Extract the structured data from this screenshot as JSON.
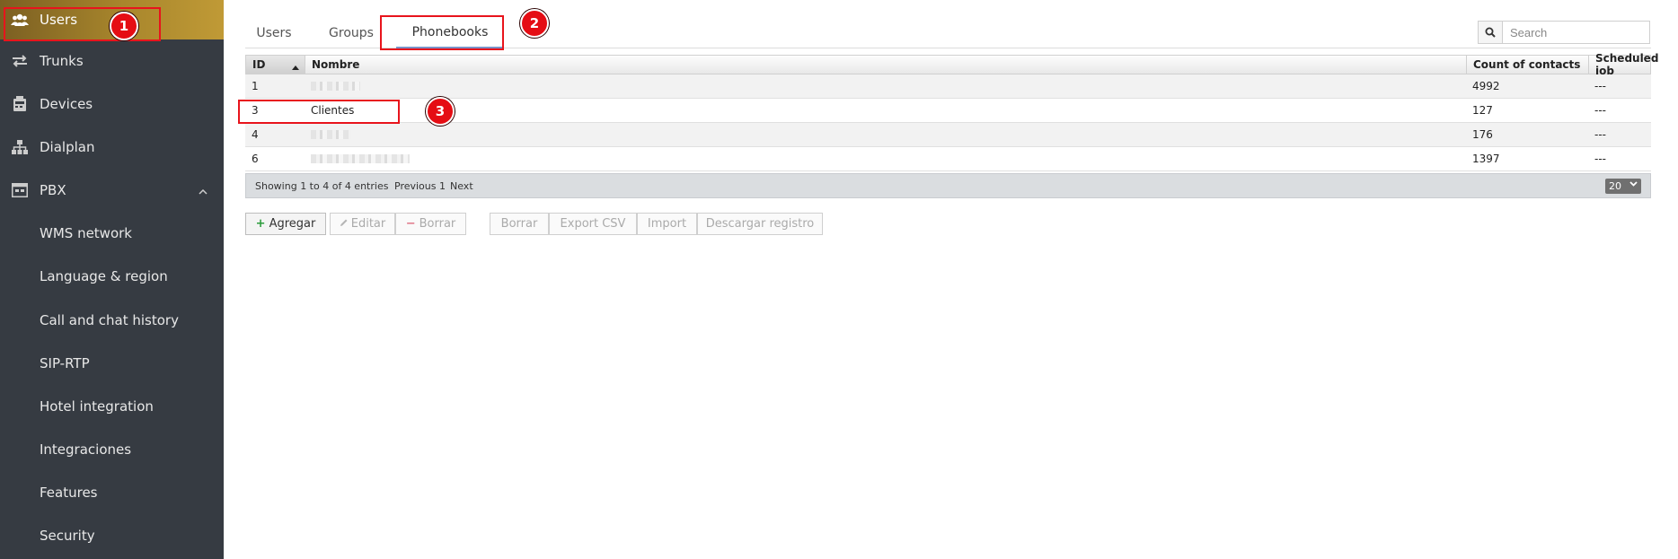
{
  "sidebar": {
    "items": [
      {
        "label": "Users",
        "icon": "users-icon"
      },
      {
        "label": "Trunks",
        "icon": "arrows-exchange-icon"
      },
      {
        "label": "Devices",
        "icon": "devices-icon"
      },
      {
        "label": "Dialplan",
        "icon": "sitemap-icon"
      },
      {
        "label": "PBX",
        "icon": "pbx-icon"
      }
    ],
    "pbx_subitems": [
      "WMS network",
      "Language & region",
      "Call and chat history",
      "SIP-RTP",
      "Hotel integration",
      "Integraciones",
      "Features",
      "Security"
    ]
  },
  "tabs": [
    "Users",
    "Groups",
    "Phonebooks"
  ],
  "active_tab": "Phonebooks",
  "search": {
    "placeholder": "Search"
  },
  "table": {
    "columns": [
      "ID",
      "Nombre",
      "Count of contacts",
      "Scheduled job"
    ],
    "rows": [
      {
        "id": "1",
        "nombre": "",
        "count": "4992",
        "job": "---"
      },
      {
        "id": "3",
        "nombre": "Clientes",
        "count": "127",
        "job": "---"
      },
      {
        "id": "4",
        "nombre": "",
        "count": "176",
        "job": "---"
      },
      {
        "id": "6",
        "nombre": "",
        "count": "1397",
        "job": "---"
      }
    ]
  },
  "footer": {
    "info": "Showing 1 to 4 of 4 entries",
    "previous": "Previous",
    "page": "1",
    "next": "Next",
    "page_size": "20"
  },
  "buttons": {
    "add": "Agregar",
    "edit": "Editar",
    "delete": "Borrar",
    "delete2": "Borrar",
    "export": "Export CSV",
    "import": "Import",
    "download_log": "Descargar registro"
  },
  "annotations": [
    "1",
    "2",
    "3"
  ],
  "colors": {
    "annotation_red": "#e50d14",
    "active_gradient": "#a8862c",
    "sidebar_bg": "#363b42"
  }
}
